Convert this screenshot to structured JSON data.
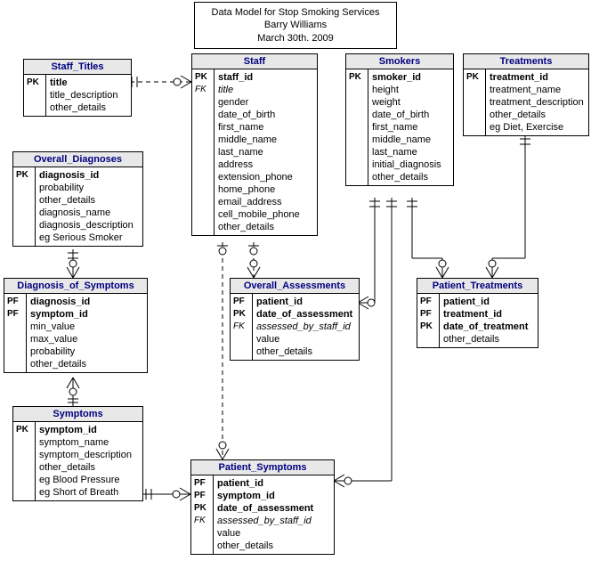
{
  "title": {
    "line1": "Data Model for Stop Smoking Services",
    "line2": "Barry Williams",
    "line3": "March 30th. 2009"
  },
  "entities": {
    "staff_titles": {
      "name": "Staff_Titles",
      "keys": [
        "PK",
        "",
        ""
      ],
      "attrs": [
        "title",
        "title_description",
        "other_details"
      ],
      "bolds": [
        true,
        false,
        false
      ],
      "italics": [
        false,
        false,
        false
      ]
    },
    "overall_diagnoses": {
      "name": "Overall_Diagnoses",
      "keys": [
        "PK",
        "",
        "",
        "",
        ""
      ],
      "attrs": [
        "diagnosis_id",
        "probability",
        "other_details",
        "diagnosis_name",
        "diagnosis_description"
      ],
      "note": "eg Serious Smoker",
      "bolds": [
        true,
        false,
        false,
        false,
        false
      ],
      "italics": [
        false,
        false,
        false,
        false,
        false
      ]
    },
    "diagnosis_of_symptoms": {
      "name": "Diagnosis_of_Symptoms",
      "keys": [
        "PF",
        "PF",
        "",
        "",
        "",
        ""
      ],
      "attrs": [
        "diagnosis_id",
        "symptom_id",
        "min_value",
        "max_value",
        "probability",
        "other_details"
      ],
      "bolds": [
        true,
        true,
        false,
        false,
        false,
        false
      ],
      "italics": [
        false,
        false,
        false,
        false,
        false,
        false
      ]
    },
    "symptoms": {
      "name": "Symptoms",
      "keys": [
        "PK",
        "",
        "",
        "",
        "",
        ""
      ],
      "attrs": [
        "symptom_id",
        "symptom_name",
        "symptom_description",
        "other_details"
      ],
      "notes": [
        "eg Blood Pressure",
        "eg Short of Breath"
      ],
      "bolds": [
        true,
        false,
        false,
        false
      ],
      "italics": [
        false,
        false,
        false,
        false
      ]
    },
    "staff": {
      "name": "Staff",
      "keys": [
        "PK",
        "FK",
        "",
        "",
        "",
        "",
        "",
        "",
        "",
        "",
        "",
        "",
        ""
      ],
      "attrs": [
        "staff_id",
        "title",
        "gender",
        "date_of_birth",
        "first_name",
        "middle_name",
        "last_name",
        "address",
        "extension_phone",
        "home_phone",
        "email_address",
        "cell_mobile_phone",
        "other_details"
      ],
      "bolds": [
        true,
        false,
        false,
        false,
        false,
        false,
        false,
        false,
        false,
        false,
        false,
        false,
        false
      ],
      "italics": [
        false,
        true,
        false,
        false,
        false,
        false,
        false,
        false,
        false,
        false,
        false,
        false,
        false
      ]
    },
    "overall_assessments": {
      "name": "Overall_Assessments",
      "keys": [
        "PF",
        "PK",
        "FK",
        "",
        ""
      ],
      "attrs": [
        "patient_id",
        "date_of_assessment",
        "assessed_by_staff_id",
        "value",
        "other_details"
      ],
      "bolds": [
        true,
        true,
        false,
        false,
        false
      ],
      "italics": [
        false,
        false,
        true,
        false,
        false
      ]
    },
    "patient_symptoms": {
      "name": "Patient_Symptoms",
      "keys": [
        "PF",
        "PF",
        "PK",
        "FK",
        "",
        ""
      ],
      "attrs": [
        "patient_id",
        "symptom_id",
        "date_of_assessment",
        "assessed_by_staff_id",
        "value",
        "other_details"
      ],
      "bolds": [
        true,
        true,
        true,
        false,
        false,
        false
      ],
      "italics": [
        false,
        false,
        false,
        true,
        false,
        false
      ]
    },
    "smokers": {
      "name": "Smokers",
      "keys": [
        "PK",
        "",
        "",
        "",
        "",
        "",
        "",
        "",
        ""
      ],
      "attrs": [
        "smoker_id",
        "height",
        "weight",
        "date_of_birth",
        "first_name",
        "middle_name",
        "last_name",
        "initial_diagnosis",
        "other_details"
      ],
      "bolds": [
        true,
        false,
        false,
        false,
        false,
        false,
        false,
        false,
        false
      ],
      "italics": [
        false,
        false,
        false,
        false,
        false,
        false,
        false,
        false,
        false
      ]
    },
    "patient_treatments": {
      "name": "Patient_Treatments",
      "keys": [
        "PF",
        "PF",
        "PK",
        ""
      ],
      "attrs": [
        "patient_id",
        "treatment_id",
        "date_of_treatment",
        "other_details"
      ],
      "bolds": [
        true,
        true,
        true,
        false
      ],
      "italics": [
        false,
        false,
        false,
        false
      ]
    },
    "treatments": {
      "name": "Treatments",
      "keys": [
        "PK",
        "",
        "",
        "",
        ""
      ],
      "attrs": [
        "treatment_id",
        "treatment_name",
        "treatment_description",
        "other_details"
      ],
      "note": "eg Diet, Exercise",
      "bolds": [
        true,
        false,
        false,
        false
      ],
      "italics": [
        false,
        false,
        false,
        false
      ]
    }
  }
}
